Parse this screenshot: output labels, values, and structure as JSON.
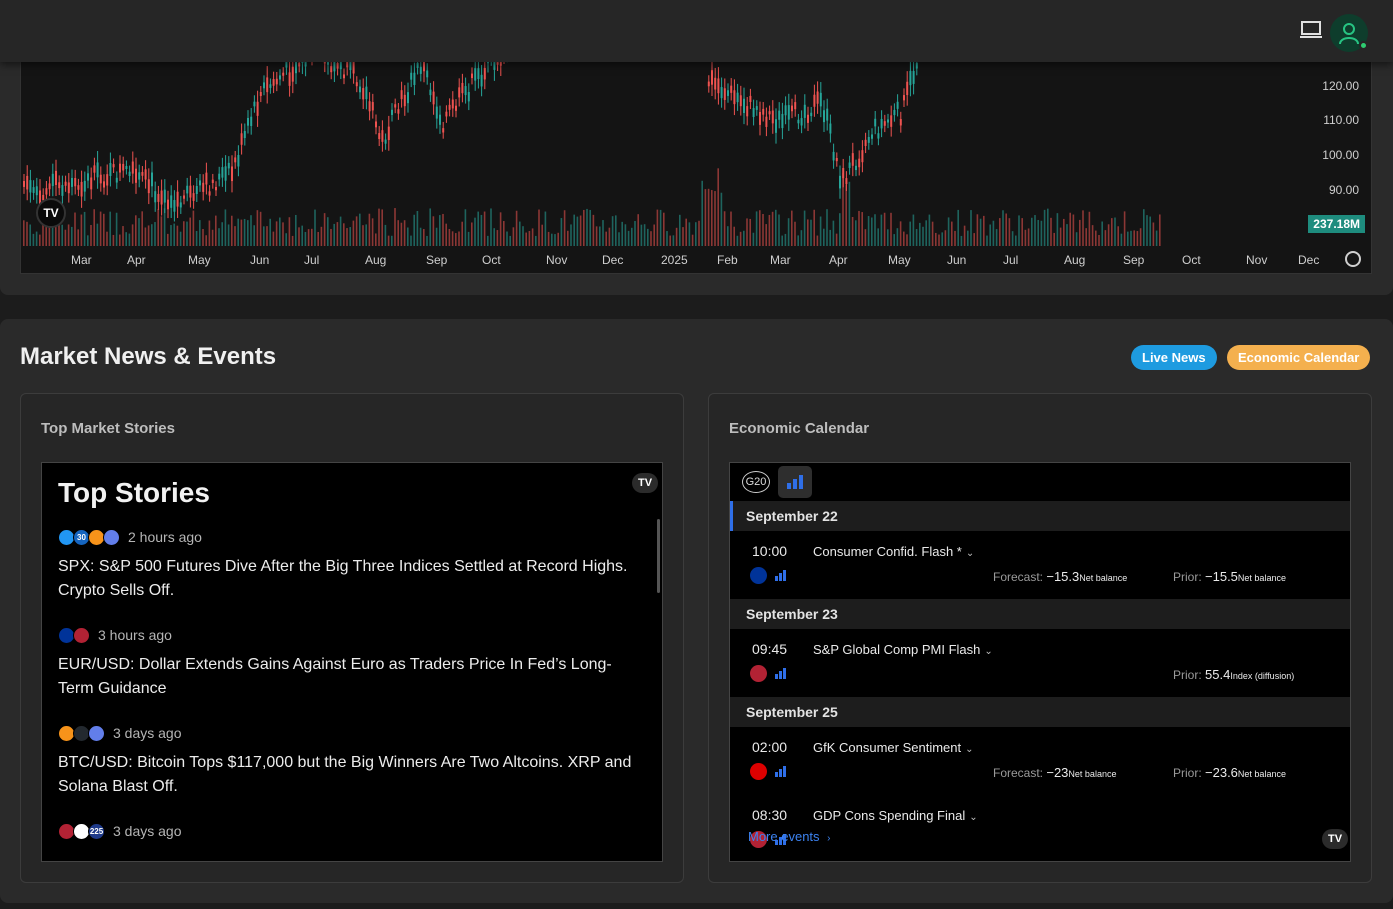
{
  "chart": {
    "price_labels": [
      "120.00",
      "110.00",
      "100.00",
      "90.00"
    ],
    "volume_badge": "237.18M",
    "months": [
      "Mar",
      "Apr",
      "May",
      "Jun",
      "Jul",
      "Aug",
      "Sep",
      "Oct",
      "Nov",
      "Dec",
      "2025",
      "Feb",
      "Mar",
      "Apr",
      "May",
      "Jun",
      "Jul",
      "Aug",
      "Sep",
      "Oct",
      "Nov",
      "Dec"
    ],
    "logo": "TV",
    "colors": {
      "up": "#26a69a",
      "down": "#ef5350"
    }
  },
  "news": {
    "section_title": "Market News & Events",
    "live_news_label": "Live News",
    "economic_calendar_label": "Economic Calendar",
    "top_stories_panel_title": "Top Market Stories",
    "calendar_panel_title": "Economic Calendar",
    "widget_title": "Top Stories",
    "stories": [
      {
        "time": "2 hours ago",
        "icons": [
          "#2196f3",
          "#1565c0",
          "#f7931a",
          "#627eea"
        ],
        "icon_texts": [
          "",
          "30",
          "",
          ""
        ],
        "headline": "SPX: S&P 500 Futures Dive After the Big Three Indices Settled at Record Highs. Crypto Sells Off."
      },
      {
        "time": "3 hours ago",
        "icons": [
          "#003399",
          "#b22234"
        ],
        "icon_texts": [
          "",
          ""
        ],
        "headline": "EUR/USD: Dollar Extends Gains Against Euro as Traders Price In Fed’s Long-Term Guidance"
      },
      {
        "time": "3 days ago",
        "icons": [
          "#f7931a",
          "#23292f",
          "#627eea"
        ],
        "icon_texts": [
          "",
          "",
          ""
        ],
        "headline": "BTC/USD: Bitcoin Tops $117,000 but the Big Winners Are Two Altcoins. XRP and Solana Blast Off."
      },
      {
        "time": "3 days ago",
        "icons": [
          "#b22234",
          "#ffffff",
          "#1e3a8a"
        ],
        "icon_texts": [
          "",
          "",
          "225"
        ],
        "headline": ""
      }
    ]
  },
  "calendar": {
    "more_events": "More events",
    "g20": "G20",
    "groups": [
      {
        "date": "September 22",
        "events": [
          {
            "time": "10:00",
            "name": "Consumer Confid. Flash *",
            "flag": "#003399",
            "forecast_label": "Forecast:",
            "forecast_value": "−15.3",
            "forecast_unit": "Net balance",
            "prior_label": "Prior:",
            "prior_value": "−15.5",
            "prior_unit": "Net balance"
          }
        ]
      },
      {
        "date": "September 23",
        "events": [
          {
            "time": "09:45",
            "name": "S&P Global Comp PMI Flash",
            "flag": "#b22234",
            "forecast_label": "",
            "forecast_value": "",
            "forecast_unit": "",
            "prior_label": "Prior:",
            "prior_value": "55.4",
            "prior_unit": "Index (diffusion)"
          }
        ]
      },
      {
        "date": "September 25",
        "events": [
          {
            "time": "02:00",
            "name": "GfK Consumer Sentiment",
            "flag": "#dd0000",
            "forecast_label": "Forecast:",
            "forecast_value": "−23",
            "forecast_unit": "Net balance",
            "prior_label": "Prior:",
            "prior_value": "−23.6",
            "prior_unit": "Net balance"
          },
          {
            "time": "08:30",
            "name": "GDP Cons Spending Final",
            "flag": "#b22234",
            "forecast_label": "",
            "forecast_value": "",
            "forecast_unit": "",
            "prior_label": "",
            "prior_value": "",
            "prior_unit": ""
          }
        ]
      }
    ]
  }
}
